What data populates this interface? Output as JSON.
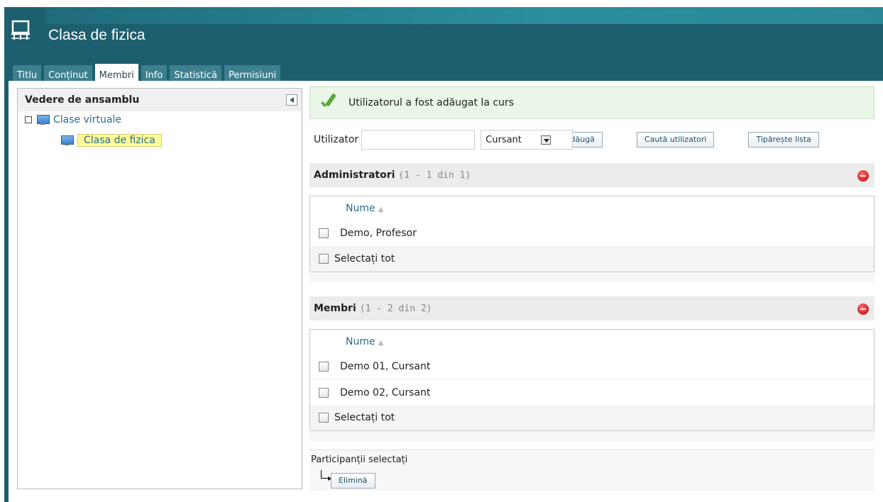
{
  "app": {
    "title": "Clasa de fizica",
    "icon": "classroom-icon"
  },
  "tabs": [
    {
      "label": "Titlu"
    },
    {
      "label": "Conținut"
    },
    {
      "label": "Membri",
      "active": true
    },
    {
      "label": "Info"
    },
    {
      "label": "Statistică"
    },
    {
      "label": "Permisiuni"
    }
  ],
  "overview": {
    "title": "Vedere de ansamblu",
    "tree": [
      {
        "label": "Clase virtuale"
      },
      {
        "label": "Clasa de fizica",
        "selected": true
      }
    ]
  },
  "message": {
    "text": "Utilizatorul a fost adăugat la curs",
    "type": "success"
  },
  "add_user": {
    "label": "Utilizator",
    "value": "",
    "role": "Cursant",
    "add_button": "Adăugă",
    "search_button": "Caută utilizatori",
    "print_button": "Tipărește lista"
  },
  "admins": {
    "title": "Administratori",
    "count": "(1 - 1 din 1)",
    "column": "Nume",
    "rows": [
      "Demo, Profesor"
    ],
    "select_all": "Selectați tot"
  },
  "members": {
    "title": "Membri",
    "count": "(1 - 2 din 2)",
    "column": "Nume",
    "rows": [
      "Demo 01, Cursant",
      "Demo 02, Cursant"
    ],
    "select_all": "Selectați tot"
  },
  "footer": {
    "label": "Participanții selectați",
    "remove_button": "Elimină"
  },
  "colors": {
    "header": "#1d5f6e",
    "accent": "#2a6a8a",
    "success_bg": "#eaf6e8",
    "highlight": "#ffff99"
  }
}
